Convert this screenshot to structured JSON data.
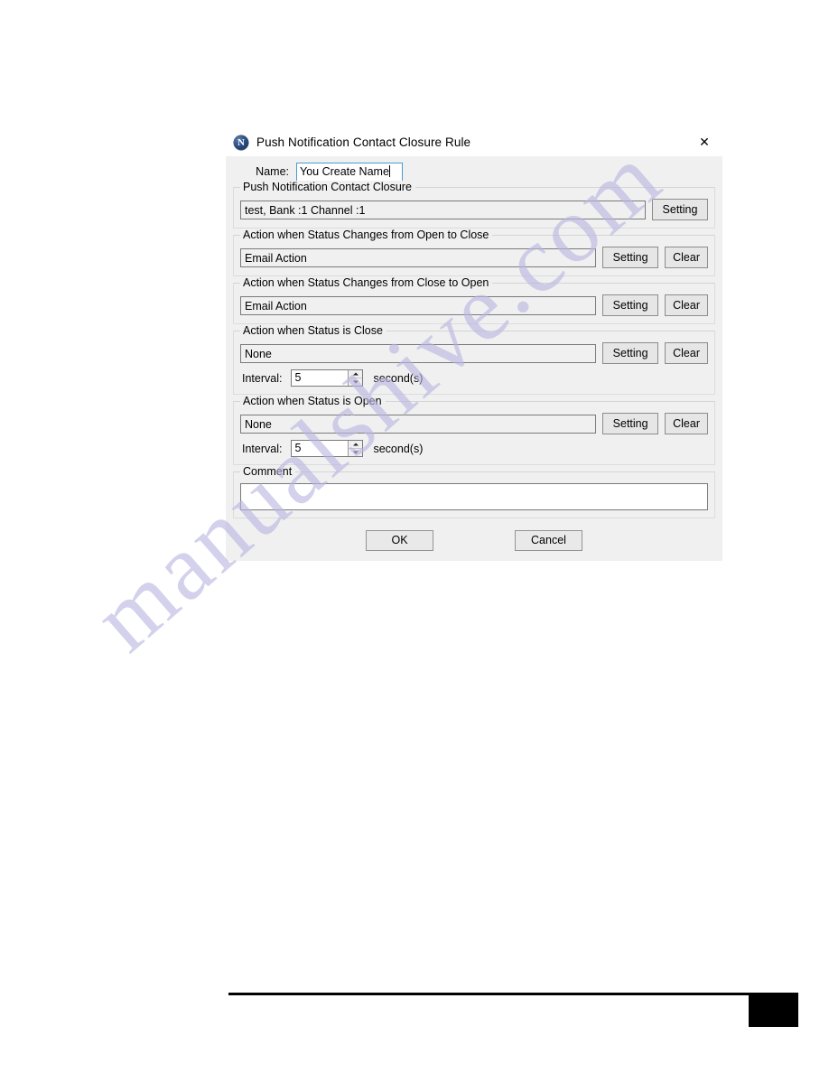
{
  "window": {
    "title": "Push Notification Contact Closure Rule",
    "app_icon": "notification-n-icon",
    "icon_letter": "N",
    "close_icon": "close-icon",
    "close_glyph": "✕"
  },
  "name_field": {
    "label": "Name:",
    "value": "You Create Name"
  },
  "sections": [
    {
      "title": "Push Notification Contact Closure",
      "value": "test, Bank :1 Channel :1",
      "setting_label": "Setting",
      "has_clear": false,
      "clear_label": "",
      "has_interval": false
    },
    {
      "title": "Action when Status Changes from Open to Close",
      "value": "Email Action",
      "setting_label": "Setting",
      "has_clear": true,
      "clear_label": "Clear",
      "has_interval": false
    },
    {
      "title": "Action when Status Changes from Close to Open",
      "value": "Email Action",
      "setting_label": "Setting",
      "has_clear": true,
      "clear_label": "Clear",
      "has_interval": false
    },
    {
      "title": "Action when Status is Close",
      "value": "None",
      "setting_label": "Setting",
      "has_clear": true,
      "clear_label": "Clear",
      "has_interval": true,
      "interval_label": "Interval:",
      "interval_value": "5",
      "interval_unit": "second(s)"
    },
    {
      "title": "Action when Status is Open",
      "value": "None",
      "setting_label": "Setting",
      "has_clear": true,
      "clear_label": "Clear",
      "has_interval": true,
      "interval_label": "Interval:",
      "interval_value": "5",
      "interval_unit": "second(s)"
    }
  ],
  "comment": {
    "title": "Comment",
    "value": ""
  },
  "footer": {
    "ok_label": "OK",
    "cancel_label": "Cancel"
  },
  "watermark": {
    "text": "manualshive.com"
  },
  "colors": {
    "dialog_background": "#f0f0f0",
    "titlebar_background": "#ffffff",
    "focus_border": "#4a9ad4",
    "button_face": "#e6e6e6",
    "field_border": "#7a7a7a",
    "watermark": "#b9b6e0",
    "app_icon": "#2b4c7e"
  }
}
